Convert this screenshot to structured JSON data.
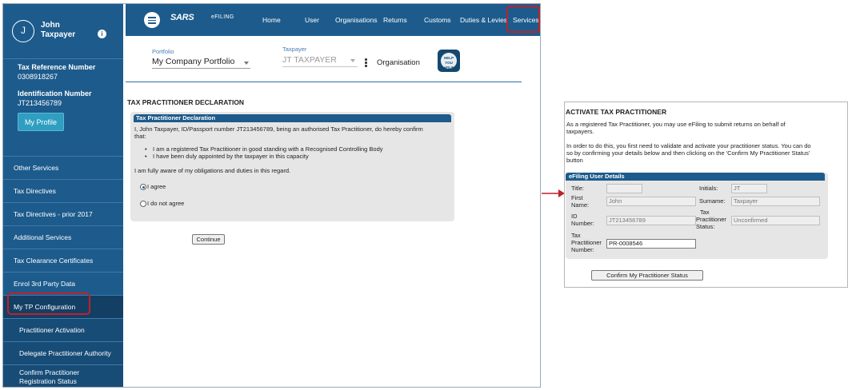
{
  "sidebar": {
    "avatar_initial": "J",
    "user_first": "John",
    "user_last": "Taxpayer",
    "info_glyph": "i",
    "tax_ref_label": "Tax Reference Number",
    "tax_ref_value": "0308918267",
    "id_label": "Identification Number",
    "id_value": "JT213456789",
    "profile_button": "My Profile",
    "items": [
      "Other Services",
      "Tax Directives",
      "Tax Directives - prior 2017",
      "Additional Services",
      "Tax Clearance Certificates",
      "Enrol 3rd Party Data",
      "My TP Configuration"
    ],
    "sub_items": [
      "Practitioner Activation",
      "Delegate Practitioner Authority",
      "Confirm Practitioner",
      "Registration Status"
    ]
  },
  "topnav": {
    "sars_logo": "SARS",
    "efiling_logo": "eFILING",
    "items": [
      "Home",
      "User",
      "Organisations",
      "Returns",
      "Customs",
      "Duties & Levies",
      "Services"
    ]
  },
  "portfolio": {
    "portfolio_caption": "Portfolio",
    "portfolio_value": "My Company Portfolio",
    "taxpayer_caption": "Taxpayer",
    "taxpayer_value": "JT TAXPAYER",
    "organisation_label": "Organisation",
    "help_badge": "HELP YOU eFILE"
  },
  "declaration": {
    "title": "TAX PRACTITIONER DECLARATION",
    "panel_heading": "Tax Practitioner Declaration",
    "intro_line1": "I, John Taxpayer, ID/Passport number JT213456789, being an authorised Tax Practitioner, do hereby confirm",
    "intro_line2": "that:",
    "bullet1": "I am a registered Tax Practitioner in good standing with a Recognised Controlling Body",
    "bullet2": "I have been duly appointed by the taxpayer in this capacity",
    "aware": "I am fully aware of my obligations and duties in this regard.",
    "agree": "I agree",
    "disagree": "I do not agree",
    "continue_button": "Continue"
  },
  "activation": {
    "title": "ACTIVATE TAX PRACTITIONER",
    "p1_line1": "As a registered Tax Practitioner, you may use eFiling to submit returns on behalf of",
    "p1_line2": "taxpayers.",
    "p2_line1": "In order to do this, you first need to validate and activate your practitioner status. You can do",
    "p2_line2": "so by confirming your details below and then clicking on the 'Confirm My Practitioner Status'",
    "p2_line3": "button",
    "panel_heading": "eFiling User Details",
    "title_label": "Title:",
    "title_value": "",
    "initials_label": "Initials:",
    "initials_value": "JT",
    "first_name_label_1": "First",
    "first_name_label_2": "Name:",
    "first_name_value": "John",
    "surname_label": "Surname:",
    "surname_value": "Taxpayer",
    "id_label_1": "ID",
    "id_label_2": "Number:",
    "id_value": "JT213456789",
    "tp_status_label_1": "Tax",
    "tp_status_label_2": "Practitioner",
    "tp_status_label_3": "Status:",
    "tp_status_value": "Unconfirmed",
    "tp_number_label_1": "Tax",
    "tp_number_label_2": "Practitioner",
    "tp_number_label_3": "Number:",
    "tp_number_value": "PR-0008546",
    "confirm_button": "Confirm My Practitioner Status"
  },
  "colors": {
    "sars_blue": "#1d5b8c",
    "highlight_red": "#c0202a"
  }
}
